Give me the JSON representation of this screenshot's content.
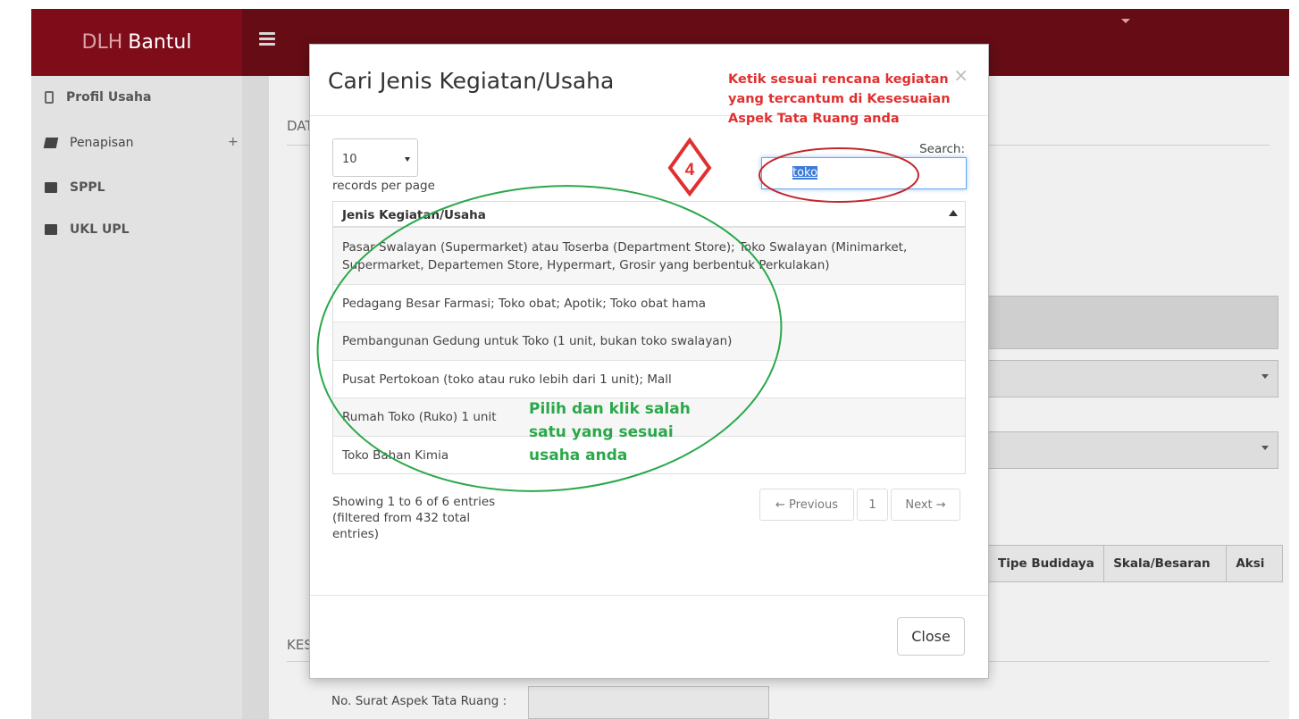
{
  "header": {
    "brand_part1": "DLH",
    "brand_part2": "Bantul"
  },
  "sidebar": {
    "items": [
      {
        "label": "Profil Usaha",
        "icon": "tablet-icon"
      },
      {
        "label": "Penapisan",
        "icon": "book-icon",
        "expand": "+"
      },
      {
        "label": "SPPL",
        "icon": "folder-icon"
      },
      {
        "label": "UKL UPL",
        "icon": "folder-icon"
      }
    ]
  },
  "background": {
    "section_dat": "DAT",
    "section_kes": "KES",
    "table_headers": [
      "Tipe Budidaya",
      "Skala/Besaran",
      "Aksi"
    ],
    "no_surat_label": "No. Surat Aspek Tata Ruang :"
  },
  "modal": {
    "title": "Cari Jenis Kegiatan/Usaha",
    "close_x": "×",
    "length_value": "10",
    "records_label": "records per page",
    "search_label": "Search:",
    "search_value": "toko",
    "column_header": "Jenis Kegiatan/Usaha",
    "rows": [
      "Pasar Swalayan (Supermarket) atau Toserba (Department Store); Toko Swalayan (Minimarket, Supermarket, Departemen Store, Hypermart, Grosir yang berbentuk Perkulakan)",
      "Pedagang Besar Farmasi; Toko obat; Apotik; Toko obat hama",
      "Pembangunan Gedung untuk Toko (1 unit, bukan toko swalayan)",
      "Pusat Pertokoan (toko atau ruko lebih dari 1 unit); Mall",
      "Rumah Toko (Ruko) 1 unit",
      "Toko Bahan Kimia"
    ],
    "info": "Showing 1 to 6 of 6 entries (filtered from 432 total entries)",
    "pager": {
      "prev": "← Previous",
      "page": "1",
      "next": "Next →"
    },
    "close_button": "Close"
  },
  "annotations": {
    "step_number": "4",
    "red_note": "Ketik sesuai rencana kegiatan yang tercantum di Kesesuaian Aspek Tata Ruang anda",
    "green_note": "Pilih dan klik salah satu yang sesuai usaha anda",
    "red_color": "#e03030",
    "green_color": "#2aa84a"
  },
  "colors": {
    "topbar": "#650c15",
    "brand_bg": "#7e0c19"
  }
}
